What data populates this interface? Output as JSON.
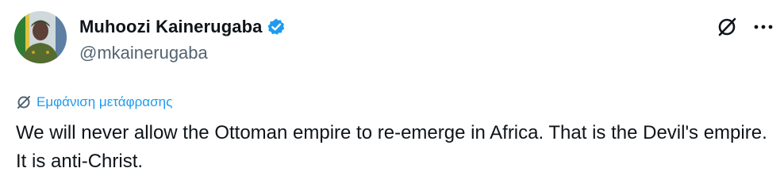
{
  "author": {
    "display_name": "Muhoozi Kainerugaba",
    "handle": "@mkainerugaba",
    "verified": true,
    "avatar_icon": "profile-photo"
  },
  "actions": {
    "grok_icon": "grok-icon",
    "more_icon": "more-horizontal-icon"
  },
  "translation": {
    "label": "Εμφάνιση μετάφρασης",
    "icon": "translate-icon"
  },
  "tweet": {
    "text": "We will never allow the Ottoman empire to re-emerge in Africa. That is the Devil's empire. It is anti-Christ."
  },
  "colors": {
    "link_blue": "#1d9bf0",
    "text_primary": "#0f1419",
    "text_secondary": "#536471",
    "verified_blue": "#1d9bf0"
  }
}
